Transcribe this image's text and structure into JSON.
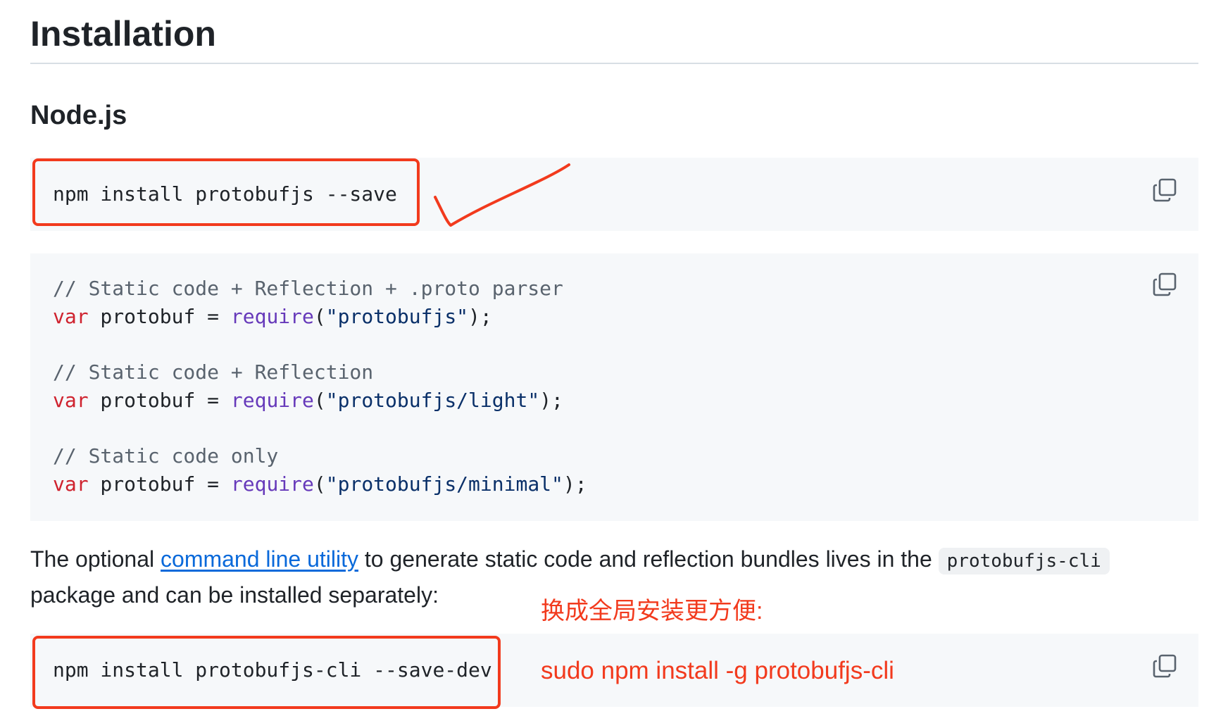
{
  "headings": {
    "installation": "Installation",
    "nodejs": "Node.js"
  },
  "code_install": {
    "line": "npm install protobufjs --save"
  },
  "code_usage": {
    "blocks": [
      {
        "comment": "// Static code + Reflection + .proto parser",
        "kw": "var",
        "ident": " protobuf = ",
        "fn": "require",
        "open": "(",
        "str": "\"protobufjs\"",
        "close": ");"
      },
      {
        "comment": "// Static code + Reflection",
        "kw": "var",
        "ident": " protobuf = ",
        "fn": "require",
        "open": "(",
        "str": "\"protobufjs/light\"",
        "close": ");"
      },
      {
        "comment": "// Static code only",
        "kw": "var",
        "ident": " protobuf = ",
        "fn": "require",
        "open": "(",
        "str": "\"protobufjs/minimal\"",
        "close": ");"
      }
    ]
  },
  "paragraph": {
    "before_link": "The optional ",
    "link": "command line utility",
    "after_link": " to generate static code and reflection bundles lives in the ",
    "inline_code": "protobufjs-cli",
    "after_code": " package and can be installed separately:"
  },
  "code_cli": {
    "line": "npm install protobufjs-cli --save-dev"
  },
  "annotations": {
    "note_cn": "换成全局安装更方便:",
    "alt_command": "sudo npm install -g protobufjs-cli",
    "color": "#f23a1d"
  },
  "icons": {
    "copy": "copy-icon"
  },
  "colors": {
    "code_bg": "#f6f8fa",
    "link": "#0969da",
    "comment": "#59636e",
    "keyword": "#cf222e",
    "function": "#6639ba",
    "string": "#0a3069"
  }
}
